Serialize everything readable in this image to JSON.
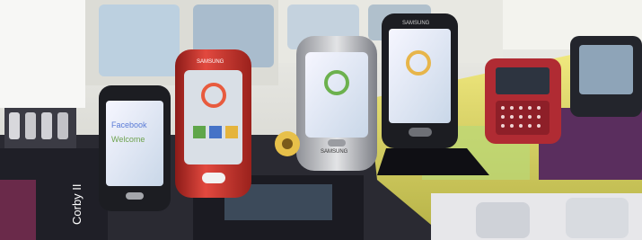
{
  "photo": {
    "brand_text": "SAMSUNG",
    "box_text_left": "Corby II",
    "phone_screen_text": [
      "Facebook",
      "Welcome"
    ]
  },
  "colors": {
    "background_white": "#f4f4f2",
    "box_yellow": "#d9d35a",
    "box_green": "#b9d978",
    "phone_red": "#d2362f",
    "phone_silver": "#c8c9cc",
    "phone_black": "#1c1d22",
    "box_purple": "#5a2e5e"
  },
  "icons": [
    "phone-icon"
  ]
}
